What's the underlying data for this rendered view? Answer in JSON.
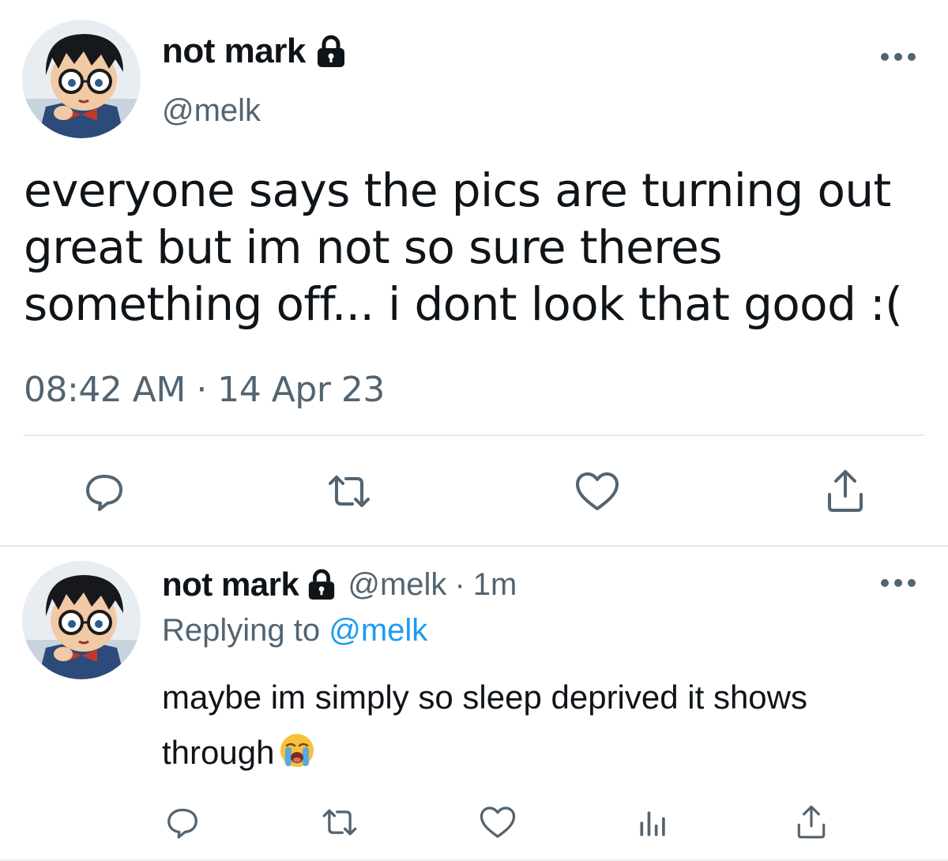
{
  "main_tweet": {
    "display_name": "not mark",
    "handle": "@melk",
    "text": "everyone says the pics are turning out great but im not so sure theres something off... i dont look that good :(",
    "timestamp": "08:42 AM · 14 Apr 23",
    "icons": [
      "lock-icon",
      "more-icon",
      "reply-icon",
      "retweet-icon",
      "like-icon",
      "share-icon"
    ]
  },
  "reply_tweet": {
    "display_name": "not mark",
    "handle": "@melk",
    "separator": "·",
    "age": "1m",
    "replying_label": "Replying to",
    "replying_handle": "@melk",
    "text": "maybe im simply so sleep deprived it shows through",
    "emoji": "loudly-crying-face",
    "icons": [
      "lock-icon",
      "more-icon",
      "reply-icon",
      "retweet-icon",
      "like-icon",
      "analytics-icon",
      "share-icon"
    ]
  },
  "colors": {
    "text": "#0f1419",
    "secondary": "#536471",
    "link": "#1d9bf0",
    "divider": "#e6e9eb"
  }
}
